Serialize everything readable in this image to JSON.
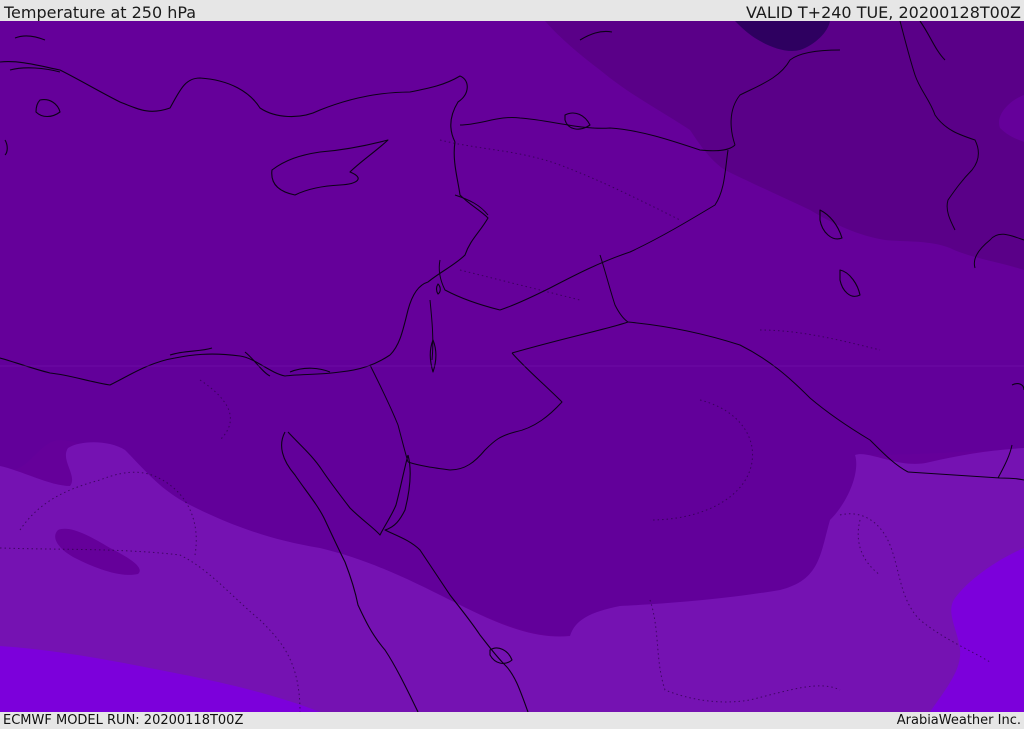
{
  "header": {
    "title": "Temperature at 250 hPa",
    "valid": "VALID T+240 TUE, 20200128T00Z"
  },
  "footer": {
    "model_run": "ECMWF MODEL RUN: 20200118T00Z",
    "credit": "ArabiaWeather Inc."
  },
  "map": {
    "colors": {
      "base": "#65009a",
      "darker": "#5a0088",
      "darkest": "#2e0060",
      "lighter": "#7512b2",
      "bright": "#7c00db",
      "coastline": "#0d0018",
      "border": "#0d0018",
      "dotted": "#2a0044"
    }
  }
}
